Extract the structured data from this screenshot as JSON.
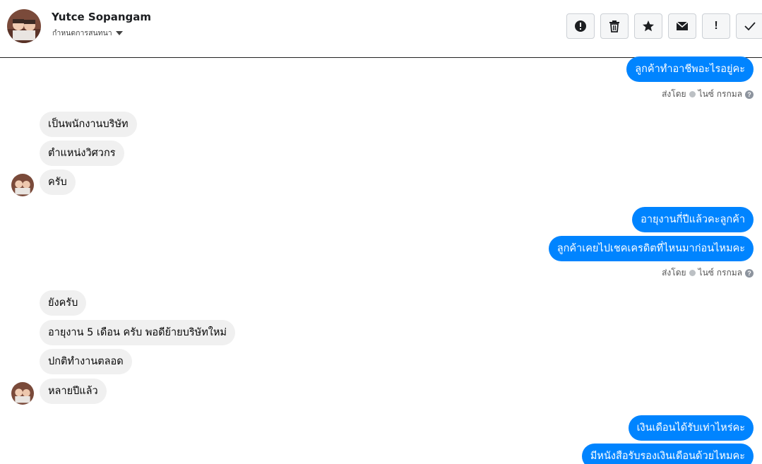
{
  "header": {
    "contact_name": "Yutce Sopangam",
    "subtitle": "กำหนดการสนทนา"
  },
  "toolbar": {
    "buttons": [
      {
        "icon": "alert-circle-icon"
      },
      {
        "icon": "trash-icon"
      },
      {
        "icon": "star-icon"
      },
      {
        "icon": "envelope-icon"
      },
      {
        "icon": "exclamation-icon",
        "label": "!"
      },
      {
        "icon": "checkmark-icon"
      }
    ]
  },
  "messages": {
    "out1": "ลูกค้าทำอาชีพอะไรอยู่คะ",
    "sent1": "ส่งโดย",
    "sender1": "ไนซ์ กรกมล",
    "in1": "เป็นพนักงานบริษัท",
    "in2": "ตำแหน่งวิศวกร",
    "in3": "ครับ",
    "out2": "อายุงานกี่ปีแล้วคะลูกค้า",
    "out3": "ลูกค้าเคยไปเชคเครดิตที่ไหนมาก่อนไหมคะ",
    "sent2": "ส่งโดย",
    "sender2": "ไนซ์ กรกมล",
    "in4": "ยังครับ",
    "in5": "อายุงาน 5 เดือน ครับ พอดีย้ายบริษัทใหม่",
    "in6": "ปกติทำงานตลอด",
    "in7": "หลายปีแล้ว",
    "out4": "เงินเดือนได้รับเท่าไหร่คะ",
    "out5": "มีหนังสือรับรองเงินเดือนด้วยไหมคะ",
    "help_glyph": "?"
  },
  "colors": {
    "outgoing_bubble": "#0084ff",
    "incoming_bubble": "#f0f0f0"
  }
}
